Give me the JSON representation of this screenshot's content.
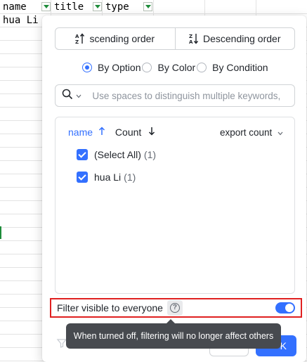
{
  "sheet": {
    "headers": [
      "name",
      "title",
      "type"
    ],
    "rows": [
      [
        "hua Li"
      ]
    ]
  },
  "sort": {
    "ascending_label": "scending order",
    "descending_label": "Descending order"
  },
  "filter_mode": {
    "options": [
      "By Option",
      "By Color",
      "By Condition"
    ],
    "selected": "By Option"
  },
  "search": {
    "placeholder": "Use spaces to distinguish multiple keywords,"
  },
  "list": {
    "sort_name_label": "name",
    "sort_count_label": "Count",
    "export_label": "export count",
    "items": [
      {
        "label": "(Select All)",
        "count": "(1)",
        "checked": true
      },
      {
        "label": "hua Li",
        "count": "(1)",
        "checked": true
      }
    ]
  },
  "visibility": {
    "label": "Filter visible to everyone",
    "help_glyph": "?",
    "enabled": true
  },
  "tooltip": {
    "text": "When turned off, filtering will no longer affect others"
  },
  "footer": {
    "confirm_label": "K"
  },
  "colors": {
    "accent": "#3370ff",
    "highlight_border": "#e02020",
    "sheet_filter": "#1e8c3a"
  }
}
